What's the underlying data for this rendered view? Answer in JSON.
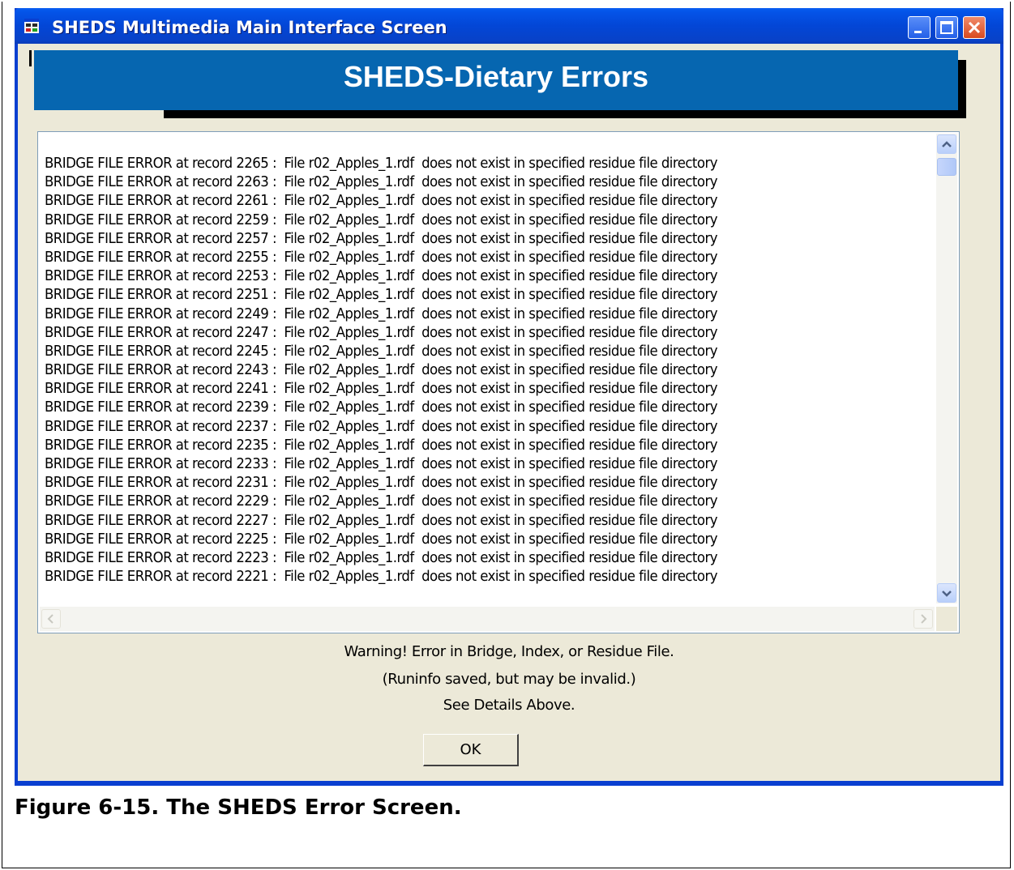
{
  "window": {
    "title": "SHEDS Multimedia Main Interface Screen",
    "icon": "app-window-icon",
    "controls": {
      "minimize": "minimize-icon",
      "maximize": "maximize-icon",
      "close": "close-icon"
    }
  },
  "banner": {
    "title": "SHEDS-Dietary Errors"
  },
  "log": {
    "lines": [
      "BRIDGE FILE ERROR at record 2265 :  File r02_Apples_1.rdf  does not exist in specified residue file directory",
      "BRIDGE FILE ERROR at record 2263 :  File r02_Apples_1.rdf  does not exist in specified residue file directory",
      "BRIDGE FILE ERROR at record 2261 :  File r02_Apples_1.rdf  does not exist in specified residue file directory",
      "BRIDGE FILE ERROR at record 2259 :  File r02_Apples_1.rdf  does not exist in specified residue file directory",
      "BRIDGE FILE ERROR at record 2257 :  File r02_Apples_1.rdf  does not exist in specified residue file directory",
      "BRIDGE FILE ERROR at record 2255 :  File r02_Apples_1.rdf  does not exist in specified residue file directory",
      "BRIDGE FILE ERROR at record 2253 :  File r02_Apples_1.rdf  does not exist in specified residue file directory",
      "BRIDGE FILE ERROR at record 2251 :  File r02_Apples_1.rdf  does not exist in specified residue file directory",
      "BRIDGE FILE ERROR at record 2249 :  File r02_Apples_1.rdf  does not exist in specified residue file directory",
      "BRIDGE FILE ERROR at record 2247 :  File r02_Apples_1.rdf  does not exist in specified residue file directory",
      "BRIDGE FILE ERROR at record 2245 :  File r02_Apples_1.rdf  does not exist in specified residue file directory",
      "BRIDGE FILE ERROR at record 2243 :  File r02_Apples_1.rdf  does not exist in specified residue file directory",
      "BRIDGE FILE ERROR at record 2241 :  File r02_Apples_1.rdf  does not exist in specified residue file directory",
      "BRIDGE FILE ERROR at record 2239 :  File r02_Apples_1.rdf  does not exist in specified residue file directory",
      "BRIDGE FILE ERROR at record 2237 :  File r02_Apples_1.rdf  does not exist in specified residue file directory",
      "BRIDGE FILE ERROR at record 2235 :  File r02_Apples_1.rdf  does not exist in specified residue file directory",
      "BRIDGE FILE ERROR at record 2233 :  File r02_Apples_1.rdf  does not exist in specified residue file directory",
      "BRIDGE FILE ERROR at record 2231 :  File r02_Apples_1.rdf  does not exist in specified residue file directory",
      "BRIDGE FILE ERROR at record 2229 :  File r02_Apples_1.rdf  does not exist in specified residue file directory",
      "BRIDGE FILE ERROR at record 2227 :  File r02_Apples_1.rdf  does not exist in specified residue file directory",
      "BRIDGE FILE ERROR at record 2225 :  File r02_Apples_1.rdf  does not exist in specified residue file directory",
      "BRIDGE FILE ERROR at record 2223 :  File r02_Apples_1.rdf  does not exist in specified residue file directory",
      "BRIDGE FILE ERROR at record 2221 :  File r02_Apples_1.rdf  does not exist in specified residue file directory"
    ],
    "scroll_icons": {
      "up": "scroll-up-icon",
      "down": "scroll-down-icon",
      "left": "scroll-left-icon",
      "right": "scroll-right-icon"
    }
  },
  "message": {
    "line1": "Warning! Error in Bridge, Index, or Residue File.",
    "line2": "(Runinfo saved, but may be invalid.)",
    "line3": "See Details Above."
  },
  "ok_label": "OK",
  "caption": "Figure 6-15. The SHEDS Error Screen.",
  "colors": {
    "titlebar": "#0454e8",
    "banner": "#0666b0",
    "client": "#ece9d8"
  }
}
